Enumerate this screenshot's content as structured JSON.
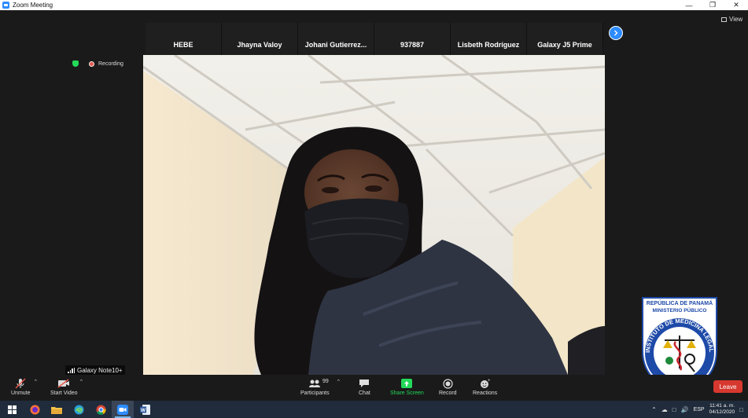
{
  "window": {
    "title": "Zoom Meeting",
    "controls": [
      "minimize",
      "maximize",
      "close"
    ]
  },
  "participants_strip": {
    "tiles": [
      {
        "name": "HEBE",
        "muted": true
      },
      {
        "name": "Jhayna Valoy",
        "muted": true
      },
      {
        "name": "Johani  Gutierrez...",
        "muted": true
      },
      {
        "name": "937887",
        "muted": true
      },
      {
        "name": "Lisbeth Rodríguez",
        "muted": true
      },
      {
        "name": "Galaxy J5 Prime",
        "muted": true
      }
    ],
    "view_label": "View"
  },
  "recording": {
    "label": "Recording"
  },
  "main_video": {
    "speaker_name": "Galaxy Note10+"
  },
  "emblem": {
    "top_line1": "REPÚBLICA DE PANAMÁ",
    "top_line2": "MINISTERIO PÚBLICO",
    "ring_text": "INSTITUTO DE MEDICINA LEGAL Y CIENCIAS FORENSES"
  },
  "toolbar": {
    "unmute": "Unmute",
    "start_video": "Start Video",
    "participants": "Participants",
    "participant_count": "99",
    "chat": "Chat",
    "share_screen": "Share Screen",
    "record": "Record",
    "reactions": "Reactions",
    "leave": "Leave"
  },
  "taskbar": {
    "apps": [
      "start-icon",
      "firefox-icon",
      "file-explorer-icon",
      "edge-icon",
      "chrome-icon",
      "zoom-icon",
      "word-icon"
    ],
    "language": "ESP",
    "time": "11:41 a. m.",
    "date": "04/12/2020"
  },
  "colors": {
    "accent_blue": "#2d8cff",
    "share_green": "#23d959",
    "leave_red": "#d6382f",
    "taskbar": "#202c3c"
  }
}
